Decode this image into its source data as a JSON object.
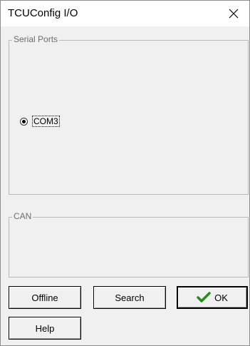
{
  "window": {
    "title": "TCUConfig I/O",
    "close_icon": "close-icon"
  },
  "serial_ports": {
    "label": "Serial Ports",
    "ports": [
      {
        "label": "COM3",
        "selected": true
      }
    ]
  },
  "can": {
    "label": "CAN"
  },
  "buttons": {
    "offline": "Offline",
    "search": "Search",
    "ok": "OK",
    "ok_icon": "checkmark-icon",
    "help": "Help"
  },
  "colors": {
    "checkmark": "#2a8a1e"
  }
}
